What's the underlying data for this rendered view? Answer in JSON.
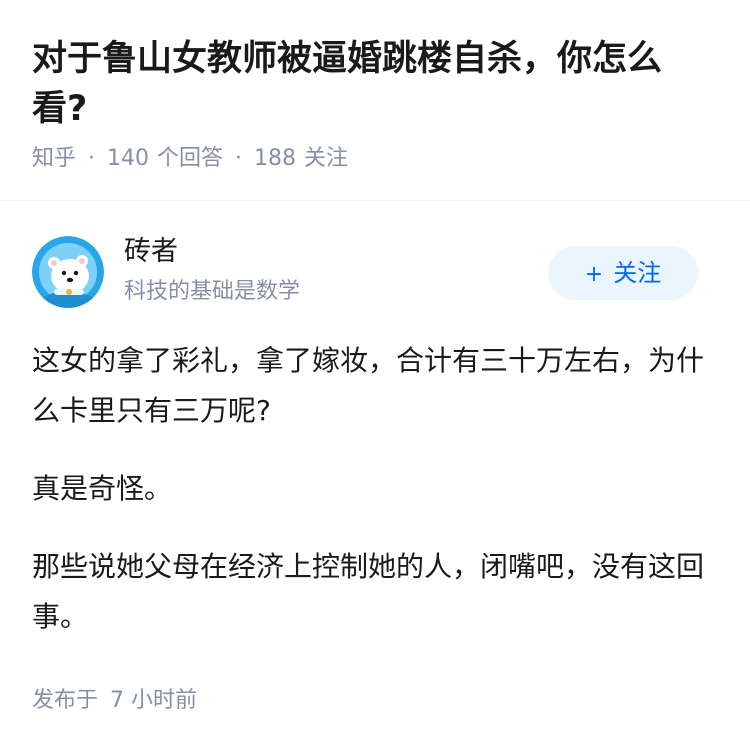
{
  "question": {
    "title": "对于鲁山女教师被逼婚跳楼自杀，你怎么看?",
    "source": "知乎",
    "separator": "·",
    "answer_count": "140",
    "answer_label": "个回答",
    "follower_count": "188",
    "follower_label": "关注"
  },
  "author": {
    "name": "砖者",
    "bio": "科技的基础是数学",
    "avatar_icon": "polar-bear-avatar-icon",
    "follow_button": {
      "icon": "+",
      "label": "关注"
    }
  },
  "answer": {
    "paragraphs": [
      "这女的拿了彩礼，拿了嫁妆，合计有三十万左右，为什么卡里只有三万呢?",
      "真是奇怪。",
      "那些说她父母在经济上控制她的人，闭嘴吧，没有这回事。"
    ],
    "publish_prefix": "发布于",
    "publish_time": "7 小时前"
  },
  "colors": {
    "title": "#1a1a1a",
    "meta": "#8590a6",
    "accent": "#0066ff",
    "follow_bg": "#ebf5fd",
    "avatar_bg": "#29a6e8"
  }
}
